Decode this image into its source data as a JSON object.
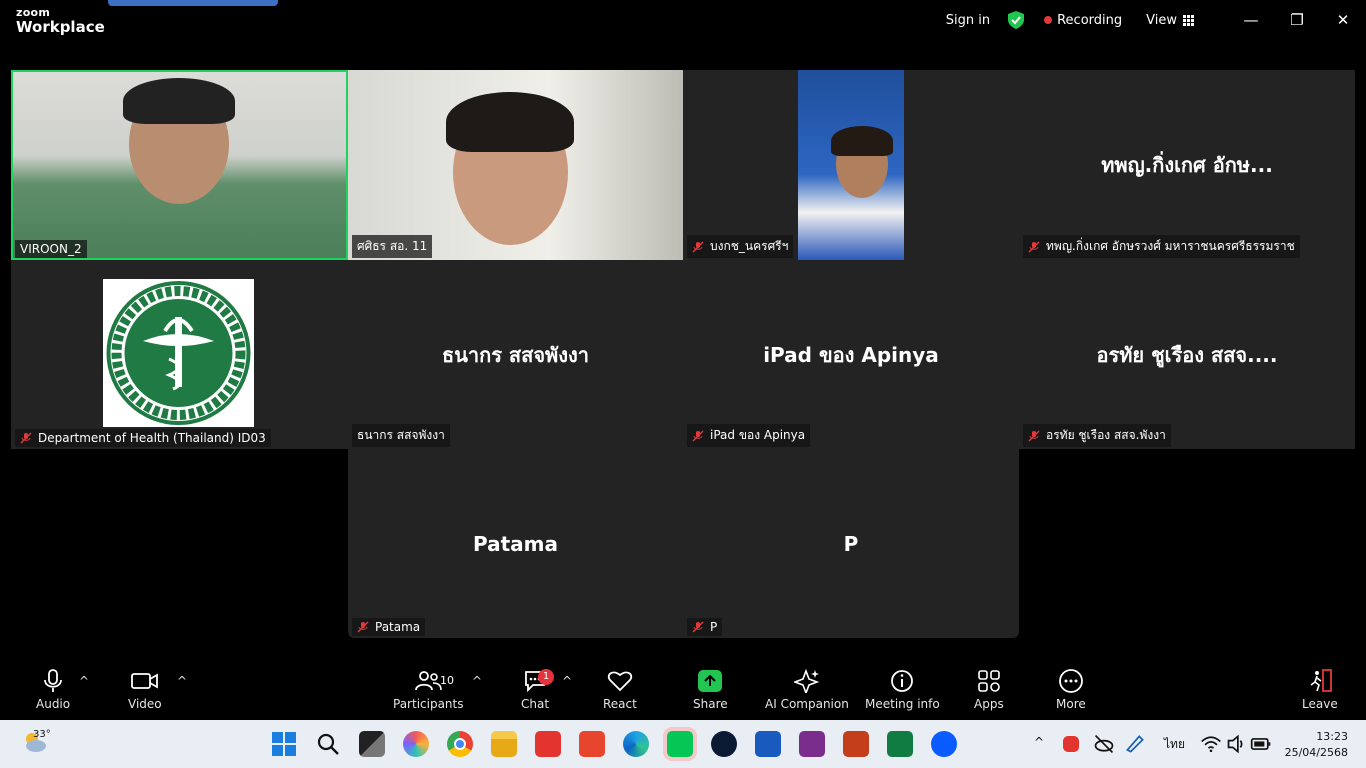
{
  "app": {
    "brand_top": "zoom",
    "brand_bottom": "Workplace"
  },
  "titlebar": {
    "sign_in": "Sign in",
    "recording": "Recording",
    "view": "View",
    "minimize": "—",
    "restore": "❐",
    "close": "✕"
  },
  "tiles": [
    {
      "label": "VIROON_2",
      "muted": false,
      "active": true
    },
    {
      "label": "ศศิธร สอ. 11",
      "muted": false
    },
    {
      "label": "บงกช_นครศรีฯ",
      "muted": true
    },
    {
      "big": "ทพญ.กิ่งเกศ อักษ...",
      "label": "ทพญ.กิ่งเกศ อักษรวงศ์ มหาราชนครศรีธรรมราช",
      "muted": true
    },
    {
      "label": "Department of Health (Thailand) ID03",
      "muted": true
    },
    {
      "big": "ธนากร สสจพังงา",
      "label": "ธนากร สสจพังงา",
      "muted": false
    },
    {
      "big": "iPad ของ Apinya",
      "label": "iPad ของ Apinya",
      "muted": true
    },
    {
      "big": "อรทัย ชูเรือง สสจ....",
      "label": "อรทัย ชูเรือง สสจ.พังงา",
      "muted": true
    },
    {
      "big": "Patama",
      "label": "Patama",
      "muted": true
    },
    {
      "big": "P",
      "label": "P",
      "muted": true
    }
  ],
  "toolbar": {
    "audio": "Audio",
    "video": "Video",
    "participants": "Participants",
    "participants_count": "10",
    "chat": "Chat",
    "chat_badge": "1",
    "react": "React",
    "share": "Share",
    "ai_companion": "AI Companion",
    "meeting_info": "Meeting info",
    "apps": "Apps",
    "more": "More",
    "leave": "Leave"
  },
  "taskbar": {
    "temperature": "33°",
    "language": "ไทย",
    "time": "13:23",
    "date": "25/04/2568"
  },
  "colors": {
    "active_speaker": "#23d160",
    "share": "#23c552",
    "recording": "#e23a3a",
    "badge": "#e5323b"
  }
}
